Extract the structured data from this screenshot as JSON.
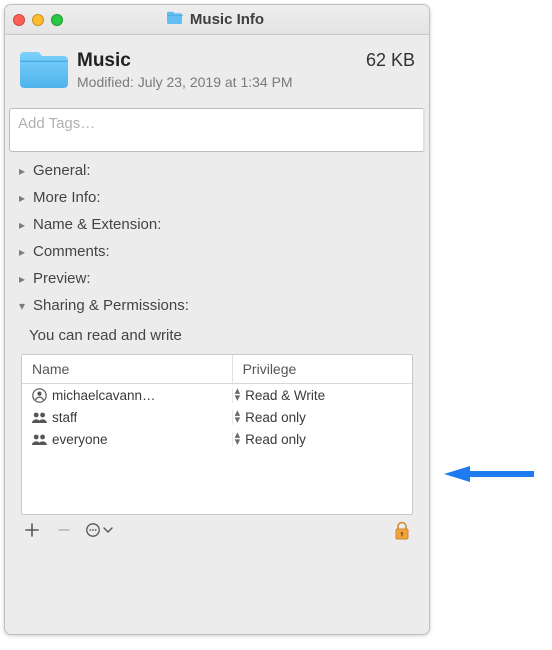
{
  "window": {
    "title": "Music Info"
  },
  "header": {
    "name": "Music",
    "size": "62 KB",
    "modified_label": "Modified:",
    "modified_value": "July 23, 2019 at 1:34 PM"
  },
  "tags": {
    "placeholder": "Add Tags…"
  },
  "sections": {
    "general": "General:",
    "more_info": "More Info:",
    "name_ext": "Name & Extension:",
    "comments": "Comments:",
    "preview": "Preview:",
    "sharing": "Sharing & Permissions:"
  },
  "sharing": {
    "note": "You can read and write",
    "columns": {
      "name": "Name",
      "priv": "Privilege"
    },
    "rows": [
      {
        "icon": "user",
        "name": "michaelcavann…",
        "priv": "Read & Write"
      },
      {
        "icon": "group",
        "name": "staff",
        "priv": "Read only"
      },
      {
        "icon": "group",
        "name": "everyone",
        "priv": "Read only"
      }
    ]
  },
  "toolbar": {
    "add": "＋",
    "remove": "−",
    "action": "⋯"
  }
}
